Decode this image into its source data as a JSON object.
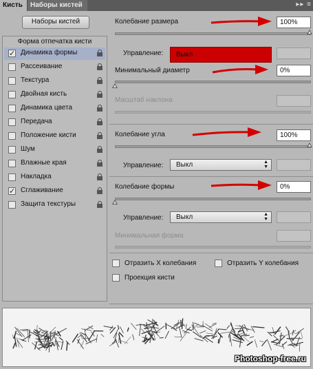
{
  "tabs": [
    {
      "label": "Кисть",
      "active": true
    },
    {
      "label": "Наборы кистей",
      "active": false
    }
  ],
  "brush_presets_button": "Наборы кистей",
  "list_header": "Форма отпечатка кисти",
  "list_items": [
    {
      "label": "Динамика формы",
      "checked": true,
      "selected": true
    },
    {
      "label": "Рассеивание",
      "checked": false
    },
    {
      "label": "Текстура",
      "checked": false
    },
    {
      "label": "Двойная кисть",
      "checked": false
    },
    {
      "label": "Динамика цвета",
      "checked": false
    },
    {
      "label": "Передача",
      "checked": false
    },
    {
      "label": "Положение кисти",
      "checked": false
    },
    {
      "label": "Шум",
      "checked": false
    },
    {
      "label": "Влажные края",
      "checked": false
    },
    {
      "label": "Накладка",
      "checked": false
    },
    {
      "label": "Сглаживание",
      "checked": true
    },
    {
      "label": "Защита текстуры",
      "checked": false
    }
  ],
  "size_jitter": {
    "label": "Колебание размера",
    "value": "100%",
    "control_label": "Управление:",
    "control_value": "Выкл"
  },
  "min_diameter": {
    "label": "Минимальный диаметр",
    "value": "0%"
  },
  "tilt_scale": {
    "label": "Масштаб наклона",
    "value": ""
  },
  "angle_jitter": {
    "label": "Колебание угла",
    "value": "100%",
    "control_label": "Управление:",
    "control_value": "Выкл"
  },
  "roundness_jitter": {
    "label": "Колебание формы",
    "value": "0%",
    "control_label": "Управление:",
    "control_value": "Выкл"
  },
  "min_roundness": {
    "label": "Минимальная форма",
    "value": ""
  },
  "flip_x": {
    "label": "Отразить X колебания",
    "checked": false
  },
  "flip_y": {
    "label": "Отразить Y колебания",
    "checked": false
  },
  "brush_projection": {
    "label": "Проекция кисти",
    "checked": false
  },
  "watermark": "Photoshop-free.ru",
  "colors": {
    "highlight_select": "#cc0000",
    "arrow": "#d40000",
    "selected_row": "#a6b1c9"
  }
}
